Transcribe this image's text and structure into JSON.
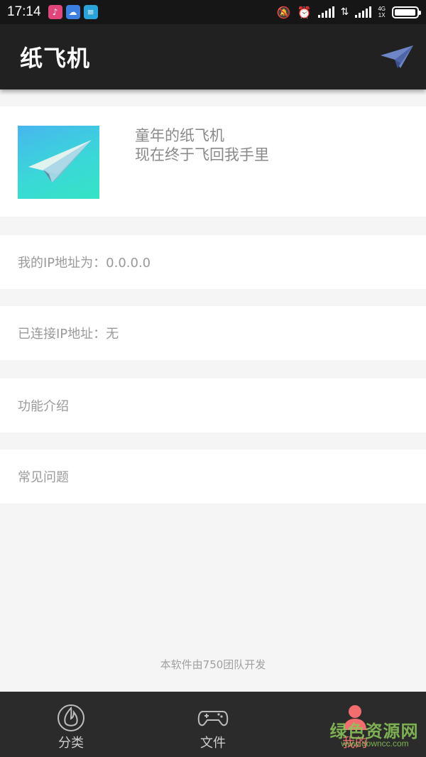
{
  "status_bar": {
    "time": "17:14",
    "network_top": "4G",
    "network_bottom": "1X",
    "battery_level": 0.95,
    "notification_icons": [
      "music-icon",
      "cloud-icon",
      "file-icon"
    ]
  },
  "app_bar": {
    "title": "纸飞机",
    "action_icon": "paper-plane-icon"
  },
  "profile": {
    "tagline_line1": "童年的纸飞机",
    "tagline_line2": "现在终于飞回我手里"
  },
  "rows": {
    "my_ip": "我的IP地址为：0.0.0.0",
    "connected_ip": "已连接IP地址：无",
    "features": "功能介绍",
    "faq": "常见问题"
  },
  "footer": {
    "note": "本软件由750团队开发"
  },
  "bottom_nav": {
    "items": [
      {
        "label": "分类",
        "icon": "flame-icon",
        "active": false
      },
      {
        "label": "文件",
        "icon": "gamepad-icon",
        "active": false
      },
      {
        "label": "我的",
        "icon": "person-icon",
        "active": true
      }
    ]
  },
  "watermark": {
    "text": "绿色资源网",
    "url": "www.downcc.com"
  },
  "colors": {
    "app_bar": "#212121",
    "active_tab": "#f26d6d",
    "background": "#f5f5f5"
  }
}
